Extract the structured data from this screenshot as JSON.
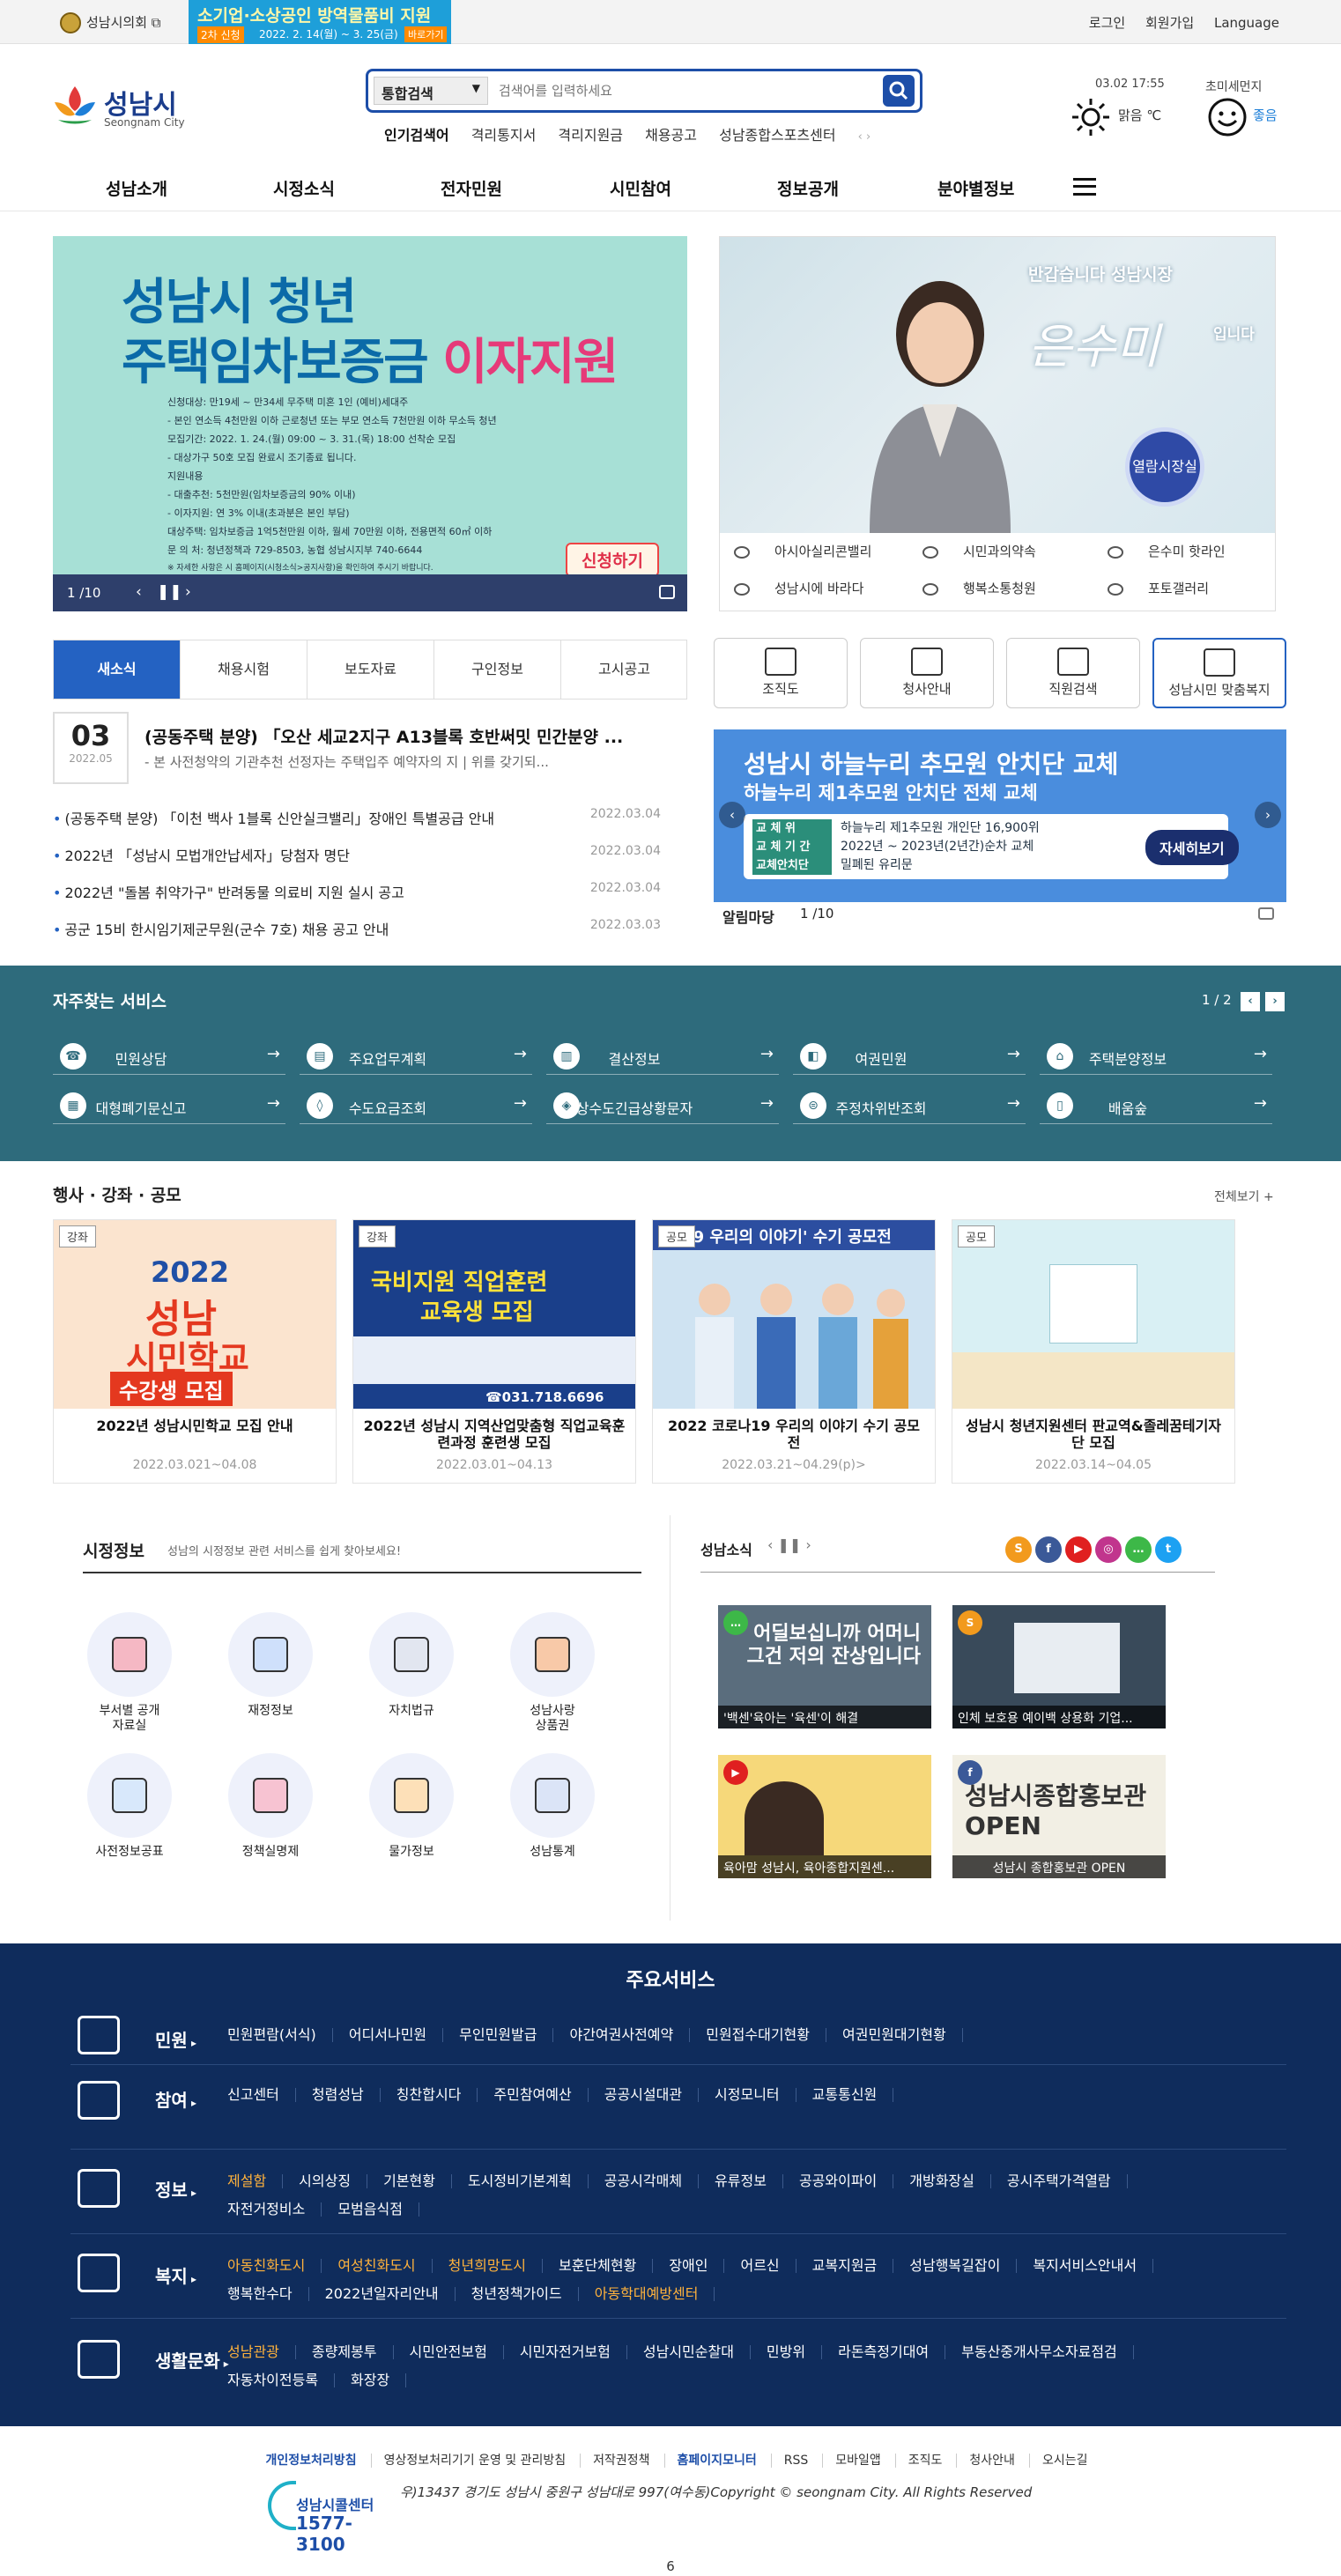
{
  "topbar": {
    "council": "성남시의회",
    "ad": {
      "line1": "소기업·소상공인 방역물품비 지원",
      "badge": "2차 신청",
      "period": "2022. 2. 14(월) ~ 3. 25(금)",
      "go": "바로가기"
    },
    "links": [
      "로그인",
      "회원가입",
      "Language"
    ]
  },
  "header": {
    "logo_ko": "성남시",
    "logo_en": "Seongnam City",
    "search": {
      "select": "통합검색",
      "placeholder": "검색어를 입력하세요"
    },
    "popular_label": "인기검색어",
    "popular": [
      "격리통지서",
      "격리지원금",
      "채용공고",
      "성남종합스포츠센터"
    ],
    "weather": {
      "datetime": "03.02 17:55",
      "text": "맑음 ℃"
    },
    "dust": {
      "label": "초미세먼지",
      "status": "좋음"
    }
  },
  "gnb": [
    "성남소개",
    "시정소식",
    "전자민원",
    "시민참여",
    "정보공개",
    "분야별정보"
  ],
  "mainvisual": {
    "title1": "성남시 청년",
    "title2a": "주택임차보증금 ",
    "title2b": "이자지원",
    "info": [
      "신청대상: 만19세 ~ 만34세 무주택 미혼 1인 (예비)세대주",
      " - 본인 연소득 4천만원 이하 근로청년 또는 부모 연소득 7천만원 이하 무소득 청년",
      "모집기간: 2022. 1. 24.(월) 09:00 ~ 3. 31.(목) 18:00 선착순 모집",
      " - 대상가구 50호 모집 완료시 조기종료 됩니다.",
      "지원내용",
      " - 대출추천: 5천만원(임차보증금의 90% 이내)",
      " - 이자지원: 연 3% 이내(초과분은 본인 부담)",
      "대상주택: 임차보증금 1억5천만원 이하, 월세 70만원 이하, 전용면적 60㎡ 이하",
      "문 의 처: 청년정책과 729-8503, 농협 성남시지부 740-6644",
      "※ 자세한 사항은 시 홈페이지(시청소식>공지사항)을 확인하여 주시기 바랍니다."
    ],
    "apply": "신청하기",
    "page": "1 /10"
  },
  "mayor": {
    "hello": "반갑습니다 성남시장",
    "sign": "은수미",
    "ida": "입니다",
    "view": "열람시장실",
    "links": [
      "아시아실리콘밸리",
      "시민과의약속",
      "은수미 핫라인",
      "성남시에 바라다",
      "행복소통청원",
      "포토갤러리"
    ]
  },
  "newstabs": [
    "새소식",
    "채용시험",
    "보도자료",
    "구인정보",
    "고시공고"
  ],
  "newstop": {
    "day": "03",
    "ym": "2022.05",
    "title": "(공동주택 분양) 「오산 세교2지구 A13블록 호반써밋 민간분양 ...",
    "desc": "- 본 사전청약의 기관추천 선정자는 주택입주 예약자의 지 | 위를 갖기되..."
  },
  "newslist": [
    {
      "t": "(공동주택 분양) 「이천 백사 1블록 신안실크밸리」장애인 특별공급 안내",
      "d": "2022.03.04"
    },
    {
      "t": "2022년 「성남시 모법개안납세자」당첨자 명단",
      "d": "2022.03.04"
    },
    {
      "t": "2022년 \"돌봄 취약가구\" 반려동물 의료비 지원 실시 공고",
      "d": "2022.03.04"
    },
    {
      "t": "공군 15비 한시임기제군무원(군수 7호) 채용 공고 안내",
      "d": "2022.03.03"
    }
  ],
  "quick4": [
    "조직도",
    "청사안내",
    "직원검색",
    "성남시민 맞춤복지"
  ],
  "notice": {
    "h": "성남시 하늘누리 추모원 안치단 교체",
    "s": "하늘누리 제1추모원 안치단 전체 교체",
    "rows": [
      {
        "k": "교 체 위",
        "v": "하늘누리 제1추모원 개인단 16,900위"
      },
      {
        "k": "교 체 기 간",
        "v": "2022년 ~ 2023년(2년간)순차 교체"
      },
      {
        "k": "교체안치단",
        "v": "밀폐된 유리문"
      }
    ],
    "more": "자세히보기",
    "label": "알림마당",
    "page": "1 /10"
  },
  "freq": {
    "title": "자주찾는 서비스",
    "page": "1 / 2",
    "items": [
      "민원상담",
      "주요업무계획",
      "결산정보",
      "여권민원",
      "주택분양정보",
      "대형폐기문신고",
      "수도요금조회",
      "상수도긴급상황문자",
      "주정차위반조회",
      "배움숲"
    ]
  },
  "events": {
    "title": "행사 · 강좌 · 공모",
    "all": "전체보기 +",
    "items": [
      {
        "tag": "강좌",
        "title": "2022년 성남시민학교 모집 안내",
        "date": "2022.03.021~04.08",
        "img1": "2022",
        "img2": "성남",
        "img3": "시민학교",
        "img4": "수강생 모집"
      },
      {
        "tag": "강좌",
        "title": "2022년 성남시 지역산업맞춤형 직업교육훈련과정 훈련생 모집",
        "date": "2022.03.01~04.13",
        "img1": "국비지원 직업훈련",
        "img2": "교육생 모집",
        "img3": "☎031.718.6696",
        "img4": ""
      },
      {
        "tag": "공모",
        "title": "2022 코로나19 우리의 이야기 수기 공모전",
        "date": "2022.03.21~04.29(p)>",
        "img1": "1119 우리의 이야기' 수기 공모전",
        "img2": "",
        "img3": "",
        "img4": ""
      },
      {
        "tag": "공모",
        "title": "성남시 청년지원센터 판교역&졸레꿈테기자단 모집",
        "date": "2022.03.14~04.05",
        "img1": "",
        "img2": "",
        "img3": "",
        "img4": ""
      }
    ]
  },
  "cityinfo": {
    "title": "시정정보",
    "sub": "성남의 시정정보 관련 서비스를 쉽게 찾아보세요!",
    "items": [
      "부서별 공개\n자료실",
      "재정정보",
      "자치법규",
      "성남사랑\n상품권",
      "사전정보공표",
      "정책실명제",
      "물가정보",
      "성남통계"
    ]
  },
  "sns": {
    "title": "성남소식",
    "items": [
      {
        "cap": "'백센'육아는 '육센'이 해결",
        "img": "어딜보십니까 어머니 그건 저의 잔상입니다",
        "badge": "talk"
      },
      {
        "cap": "인체 보호용 예이백 상용화 기업...",
        "img": "",
        "badge": "story"
      },
      {
        "cap": "육아맘 성남시, 육아종합지원센...",
        "img": "",
        "badge": "youtube"
      },
      {
        "cap": "성남시 종합홍보관 OPEN",
        "img": "성남시종합홍보관 OPEN",
        "badge": "facebook"
      }
    ]
  },
  "mainservices": {
    "title": "주요서비스",
    "rows": [
      {
        "cat": "민원",
        "links": [
          "민원편람(서식)",
          "어디서나민원",
          "무인민원발급",
          "야간여권사전예약",
          "민원접수대기현황",
          "여권민원대기현황"
        ]
      },
      {
        "cat": "참여",
        "links": [
          "신고센터",
          "청렴성남",
          "칭찬합시다",
          "주민참여예산",
          "공공시설대관",
          "시정모니터",
          "교통통신원"
        ]
      },
      {
        "cat": "정보",
        "links": [
          "제설함",
          "시의상징",
          "기본현황",
          "도시정비기본계획",
          "공공시각매체",
          "유류정보",
          "공공와이파이",
          "개방화장실",
          "공시주택가격열람",
          "자전거정비소",
          "모범음식점"
        ]
      },
      {
        "cat": "복지",
        "links": [
          "아동친화도시",
          "여성친화도시",
          "청년희망도시",
          "보훈단체현황",
          "장애인",
          "어르신",
          "교복지원금",
          "성남행복길잡이",
          "복지서비스안내서",
          "행복한수다",
          "2022년일자리안내",
          "청년정책가이드",
          "아동학대예방센터"
        ]
      },
      {
        "cat": "생활문화",
        "links": [
          "성남관광",
          "종량제봉투",
          "시민안전보험",
          "시민자전거보험",
          "성남시민순찰대",
          "민방위",
          "라돈측정기대여",
          "부동산중개사무소자료점검",
          "자동차이전등록",
          "화장장"
        ]
      }
    ]
  },
  "footer": {
    "links": [
      "개인정보처리방침",
      "영상정보처리기기 운영 및 관리방침",
      "저작권정책",
      "홈페이지모니터",
      "RSS",
      "모바일앱",
      "조직도",
      "청사안내",
      "오시는길"
    ],
    "callcenter": "성남시콜센터",
    "callnum": "1577-3100",
    "address": "우)13437 경기도 성남시 중원구 성남대로 997(여수동)Copyright © seongnam City. All Rights Reserved",
    "pagenum": "6"
  },
  "colors": {
    "brand": "#1d4ea8",
    "tab": "#2462c2",
    "freq": "#2e6b7c",
    "services": "#0f2c5c",
    "accent": "#ffb23c"
  }
}
